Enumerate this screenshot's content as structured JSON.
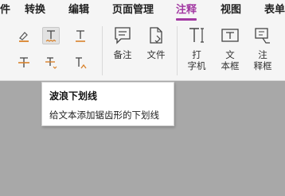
{
  "tabs": [
    {
      "label": "转换"
    },
    {
      "label": "编辑"
    },
    {
      "label": "页面管理"
    },
    {
      "label": "注释",
      "active": true
    },
    {
      "label": "视图"
    },
    {
      "label": "表单"
    }
  ],
  "ribbon": {
    "text_markup_tools": [
      {
        "icon": "highlight-pen-icon"
      },
      {
        "icon": "squiggly-underline-icon",
        "selected": true
      },
      {
        "icon": "underline-icon"
      },
      {
        "icon": "strikethrough-icon"
      },
      {
        "icon": "replace-text-icon"
      },
      {
        "icon": "insert-text-icon"
      }
    ],
    "note_label": "备注",
    "file_label": "文件",
    "typewriter_label": "打\n字机",
    "textbox_label": "文\n本框",
    "callout_label": "注\n释框"
  },
  "tooltip": {
    "title": "波浪下划线",
    "description": "给文本添加锯齿形的下划线"
  },
  "colors": {
    "accent": "#a33aa3",
    "ribbon_bg": "#f5f5f5",
    "canvas_bg": "#a8a8a8",
    "markup_orange": "#d9822b"
  }
}
